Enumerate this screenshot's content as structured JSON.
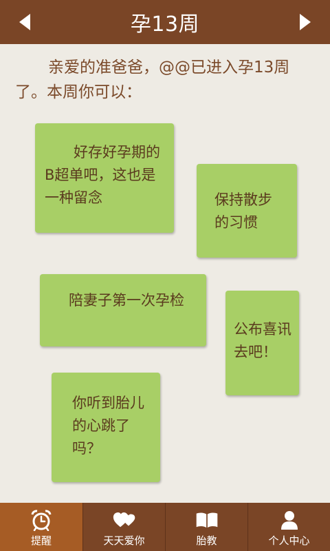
{
  "header": {
    "title": "孕13周",
    "prev_icon": "chevron-left-icon",
    "next_icon": "chevron-right-icon"
  },
  "intro": {
    "text": "亲爱的准爸爸，@@已进入孕13周了。本周你可以："
  },
  "notes": [
    {
      "text": "好存好孕期的B超单吧，这也是一种留念"
    },
    {
      "text": "保持散步的习惯"
    },
    {
      "text": "陪妻子第一次孕检"
    },
    {
      "text": "公布喜讯去吧！"
    },
    {
      "text": "你听到胎儿的心跳了吗？"
    }
  ],
  "tabs": [
    {
      "label": "提醒",
      "icon": "alarm-clock-icon",
      "active": true
    },
    {
      "label": "天天爱你",
      "icon": "hearts-icon",
      "active": false
    },
    {
      "label": "胎教",
      "icon": "book-icon",
      "active": false
    },
    {
      "label": "个人中心",
      "icon": "user-icon",
      "active": false
    }
  ],
  "colors": {
    "header_bg": "#7a4526",
    "tab_active_bg": "#a65c25",
    "page_bg": "#eeebe4",
    "note_bg": "#a8cf66",
    "text_brown": "#7b4a2a"
  }
}
